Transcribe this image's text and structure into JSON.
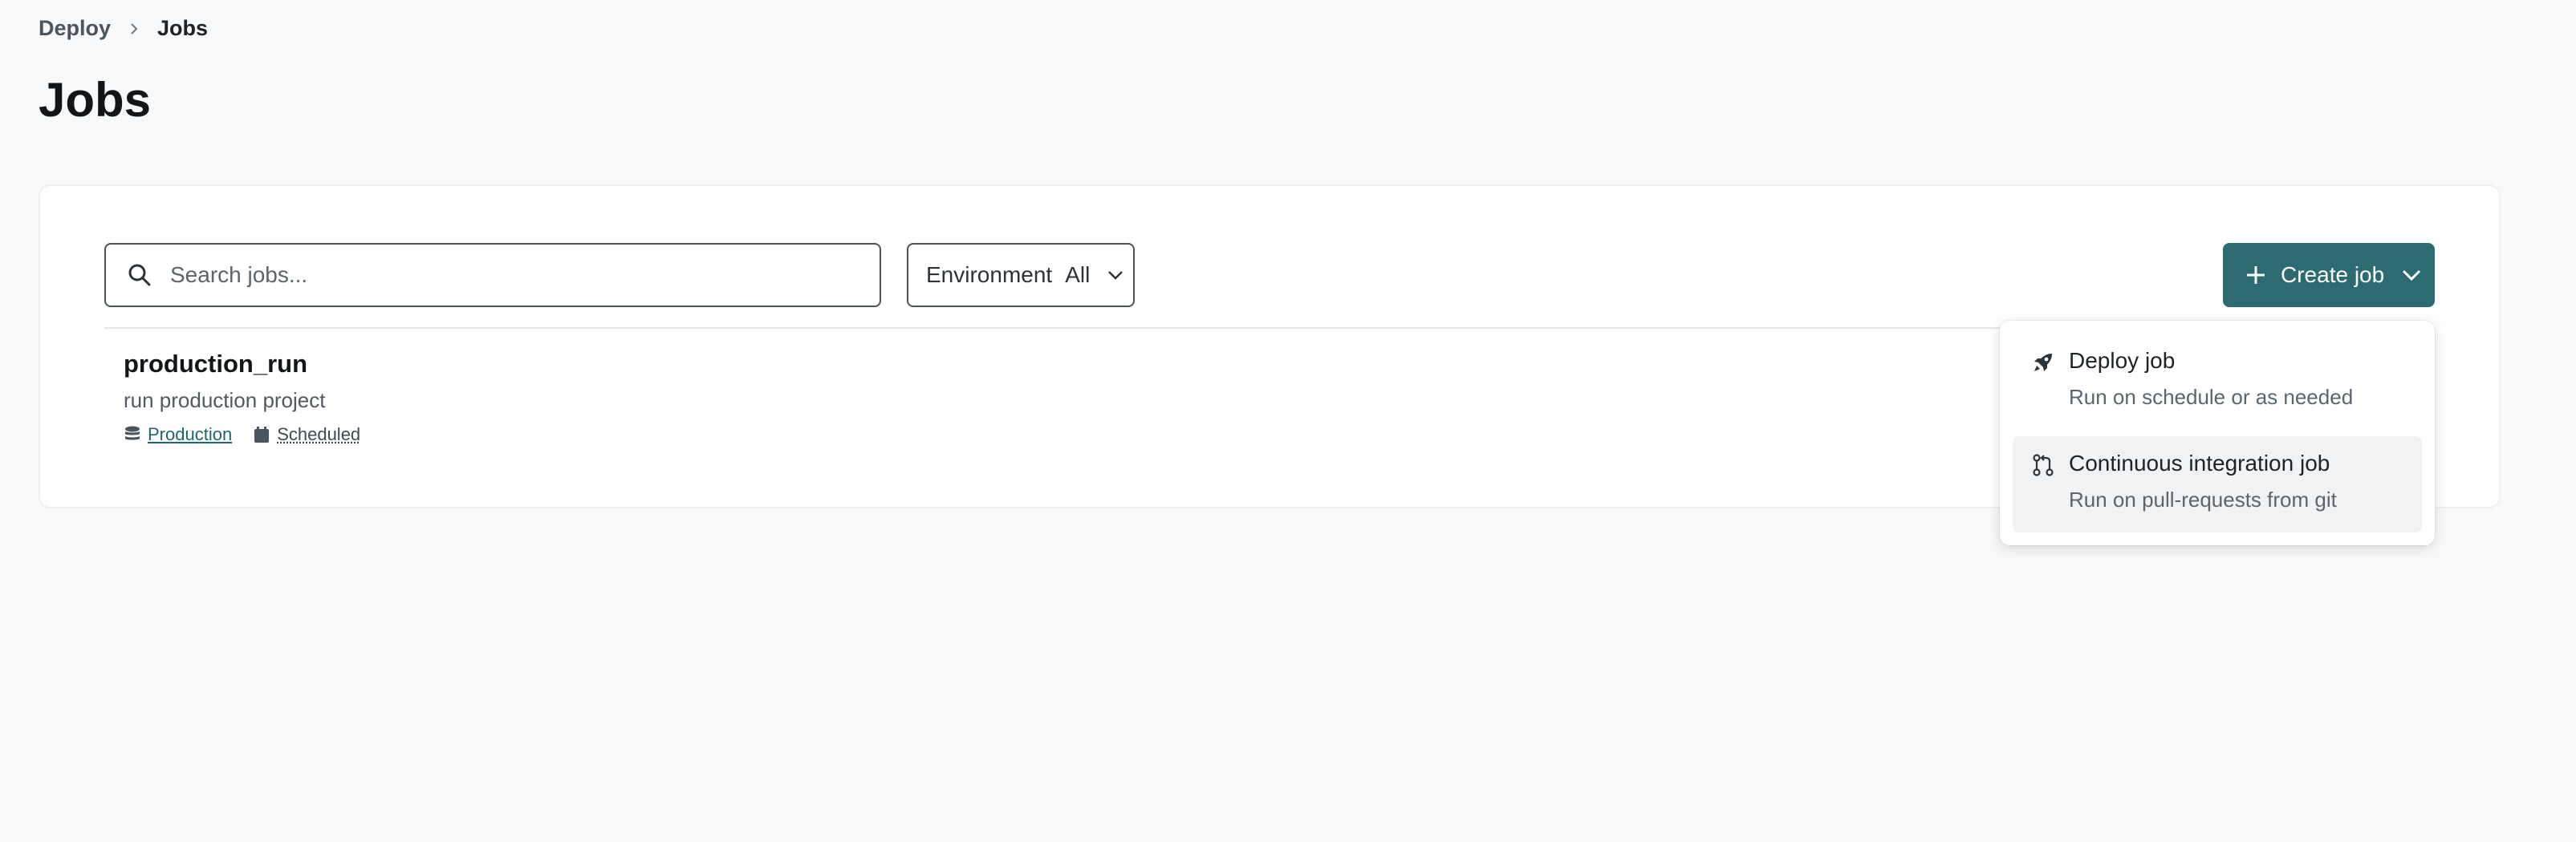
{
  "breadcrumb": {
    "parent": "Deploy",
    "current": "Jobs"
  },
  "page": {
    "title": "Jobs"
  },
  "toolbar": {
    "search_placeholder": "Search jobs...",
    "environment_label": "Environment",
    "environment_value": "All",
    "create_label": "Create job"
  },
  "jobs": [
    {
      "name": "production_run",
      "description": "run production project",
      "environment": "Production",
      "trigger": "Scheduled"
    }
  ],
  "create_menu": {
    "items": [
      {
        "title": "Deploy job",
        "subtitle": "Run on schedule or as needed",
        "icon": "rocket-icon"
      },
      {
        "title": "Continuous integration job",
        "subtitle": "Run on pull-requests from git",
        "icon": "git-pull-request-icon"
      }
    ]
  },
  "colors": {
    "accent": "#2c6b6f",
    "background": "#f8f9fb",
    "link": "#1f6670"
  }
}
